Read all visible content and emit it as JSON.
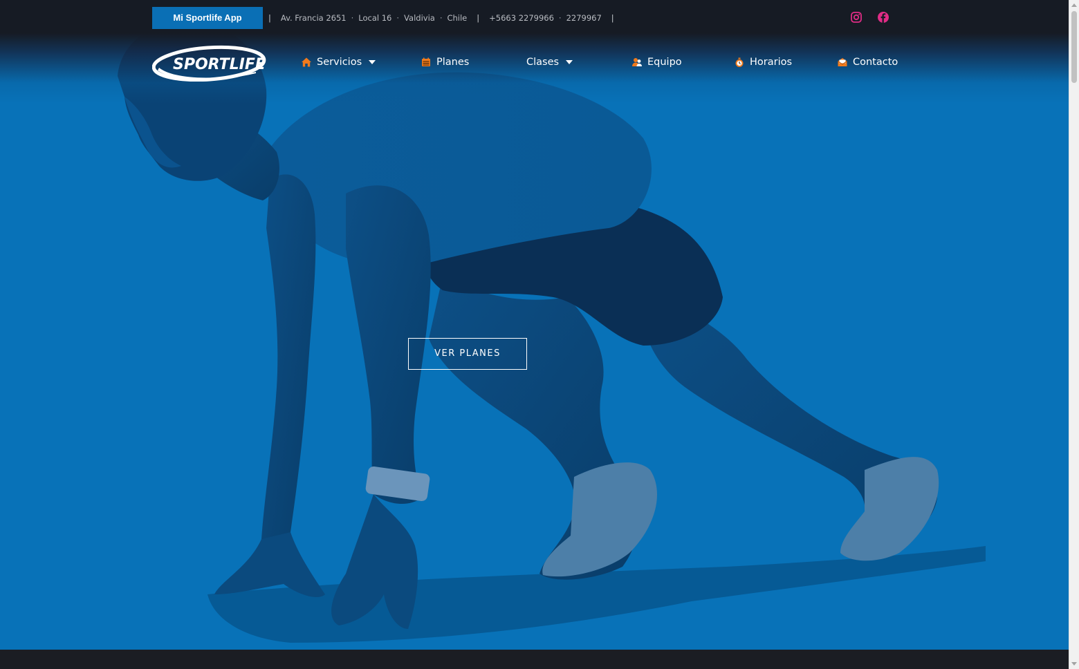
{
  "topbar": {
    "app_button": "Mi Sportlife App",
    "address": "Av. Francia 2651",
    "local": "Local 16",
    "city": "Valdivia",
    "country": "Chile",
    "phone1": "+5663 2279966",
    "phone2": "2279967",
    "separator": "|",
    "dot": "·",
    "social": [
      {
        "icon": "instagram-icon",
        "color": "#e02c86"
      },
      {
        "icon": "facebook-icon",
        "color": "#e02c86"
      }
    ]
  },
  "brand": {
    "logo_text": "SPORTLIFE"
  },
  "nav": {
    "items": [
      {
        "label": "Servicios",
        "icon": "home-icon",
        "has_dropdown": true
      },
      {
        "label": "Planes",
        "icon": "calendar-icon",
        "has_dropdown": false
      },
      {
        "label": "Clases",
        "icon": "",
        "has_dropdown": true
      },
      {
        "label": "Equipo",
        "icon": "team-icon",
        "has_dropdown": false
      },
      {
        "label": "Horarios",
        "icon": "stopwatch-icon",
        "has_dropdown": false
      },
      {
        "label": "Contacto",
        "icon": "envelope-icon",
        "has_dropdown": false
      }
    ],
    "icon_color": "#f07a1c"
  },
  "hero": {
    "cta_label": "VER PLANES",
    "background_color": "#0872b8"
  }
}
